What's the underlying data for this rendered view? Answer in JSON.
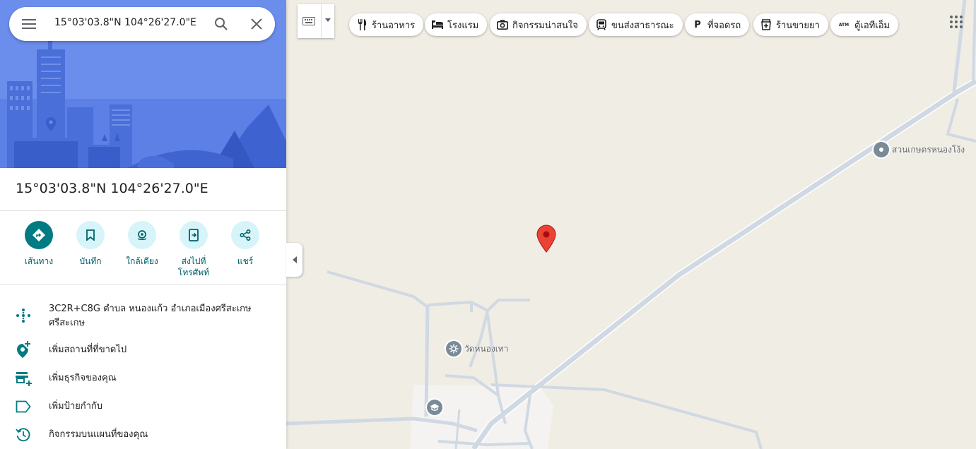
{
  "search": {
    "query": "15°03'03.8\"N 104°26'27.0\"E",
    "menu_icon": "menu-icon",
    "search_icon": "search-icon",
    "close_icon": "close-icon"
  },
  "place": {
    "title": "15°03'03.8\"N 104°26'27.0\"E"
  },
  "actions": [
    {
      "label": "เส้นทาง",
      "icon": "directions-icon"
    },
    {
      "label": "บันทึก",
      "icon": "bookmark-icon"
    },
    {
      "label": "ใกล้เคียง",
      "icon": "nearby-icon"
    },
    {
      "label": "ส่งไปที่โทรศัพท์",
      "icon": "send-to-phone-icon"
    },
    {
      "label": "แชร์",
      "icon": "share-icon"
    }
  ],
  "details": [
    {
      "text": "3C2R+C8G ตำบล หนองแก้ว อำเภอเมืองศรีสะเกษ ศรีสะเกษ",
      "icon": "plus-code-icon"
    },
    {
      "text": "เพิ่มสถานที่ที่ขาดไป",
      "icon": "add-place-icon"
    },
    {
      "text": "เพิ่มธุรกิจของคุณ",
      "icon": "add-business-icon"
    },
    {
      "text": "เพิ่มป้ายกำกับ",
      "icon": "label-icon"
    },
    {
      "text": "กิจกรรมบนแผนที่ของคุณ",
      "icon": "history-icon"
    }
  ],
  "chips": [
    {
      "label": "ร้านอาหาร",
      "icon": "restaurant-icon"
    },
    {
      "label": "โรงแรม",
      "icon": "hotel-icon"
    },
    {
      "label": "กิจกรรมน่าสนใจ",
      "icon": "camera-icon"
    },
    {
      "label": "ขนส่งสาธารณะ",
      "icon": "transit-icon"
    },
    {
      "label": "ที่จอดรถ",
      "icon": "parking-icon"
    },
    {
      "label": "ร้านขายยา",
      "icon": "pharmacy-icon"
    },
    {
      "label": "ตู้เอทีเอ็ม",
      "icon": "atm-icon"
    }
  ],
  "chip_icon_text": {
    "parking": "P",
    "atm": "ATM"
  },
  "map_pois": [
    {
      "label": "สวนเกษตรหนองโง้ง",
      "icon": "place-icon"
    },
    {
      "label": "วัดหนองเทา",
      "icon": "temple-icon"
    },
    {
      "label": "",
      "icon": "school-icon"
    }
  ],
  "colors": {
    "accent": "#007b83",
    "accent_light": "#d6f4f9",
    "marker": "#ea4335",
    "map_bg": "#f0ede4",
    "road": "#d0d9e3"
  }
}
